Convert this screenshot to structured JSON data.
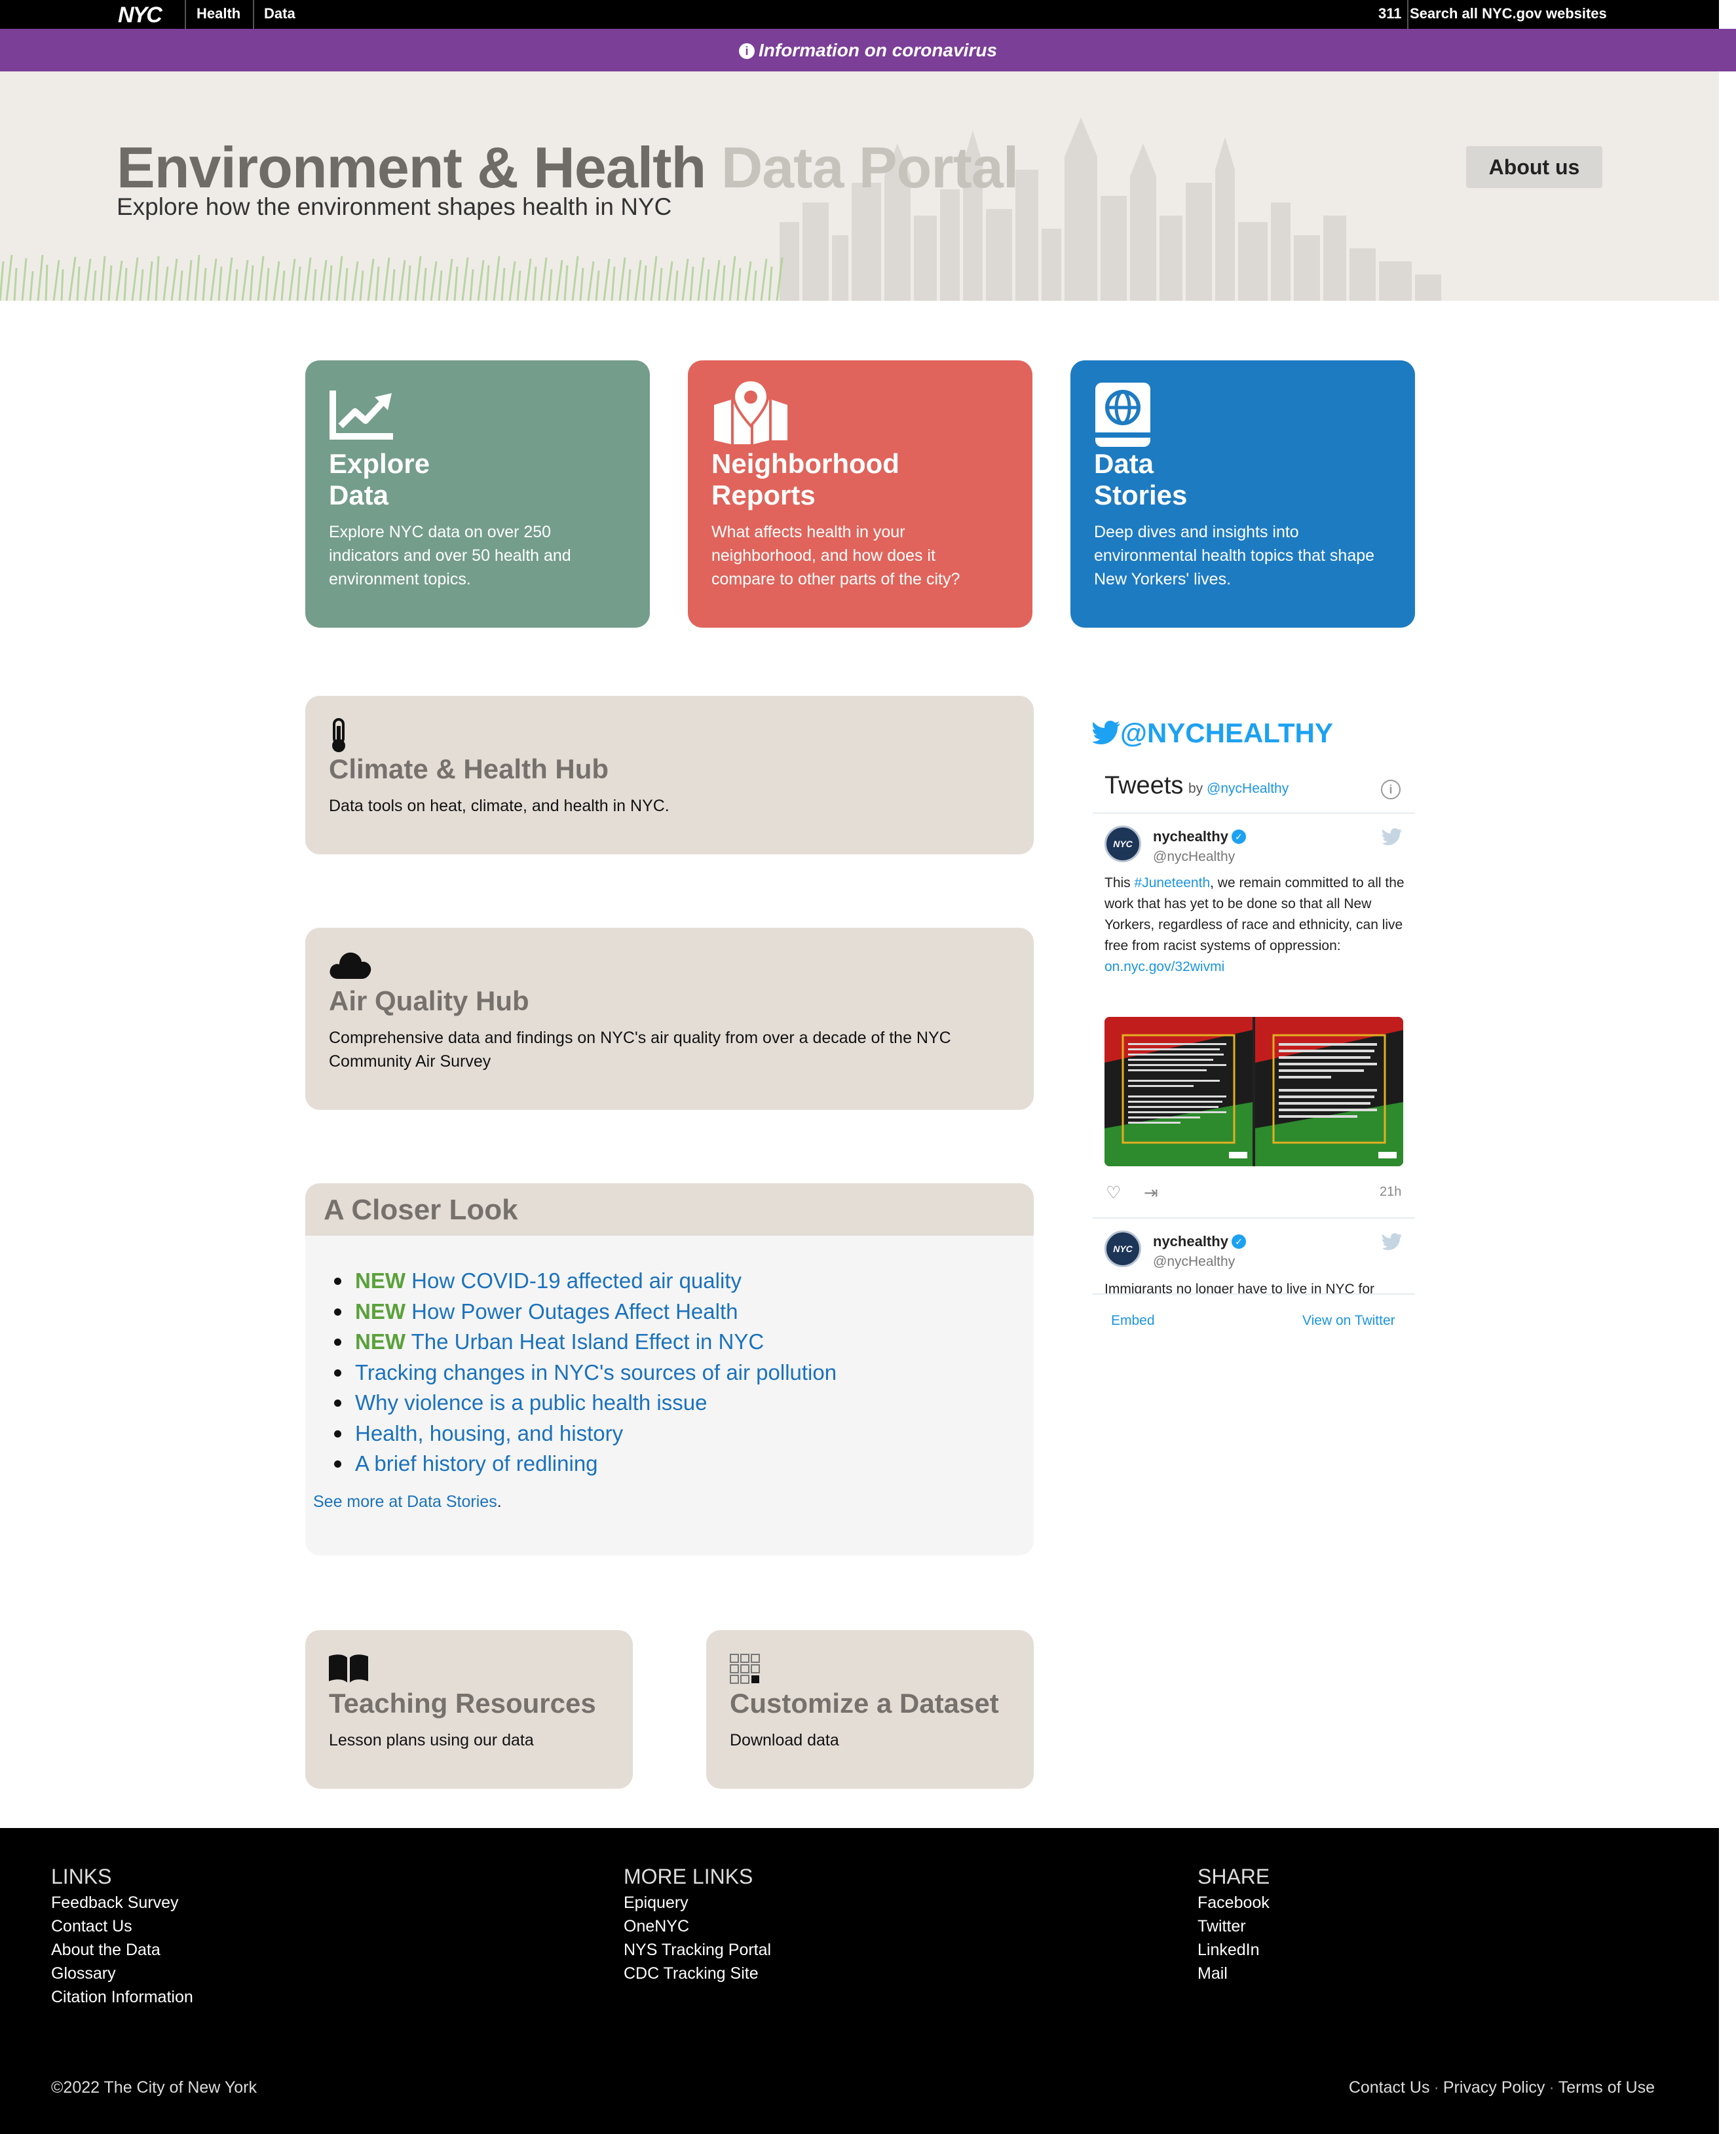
{
  "topbar": {
    "logo": "NYC",
    "links": [
      "Health",
      "Data"
    ],
    "right_311": "311",
    "right_search": "Search all NYC.gov websites"
  },
  "banner": {
    "text": "Information on coronavirus"
  },
  "hero": {
    "title_dark": "Environment & Health ",
    "title_light": "Data Portal",
    "subtitle": "Explore how the environment shapes health in NYC",
    "about_button": "About us"
  },
  "cards": [
    {
      "title": "Explore\nData",
      "desc": "Explore NYC data on over 250 indicators and over 50 health and environment topics.",
      "color": "#749d8c",
      "icon": "line-chart-icon"
    },
    {
      "title": "Neighborhood\nReports",
      "desc": "What affects health in your neighborhood, and how does it compare to other parts of the city?",
      "color": "#e0645b",
      "icon": "map-pin-icon"
    },
    {
      "title": "Data\nStories",
      "desc": "Deep dives and insights into environmental health topics that shape New Yorkers' lives.",
      "color": "#1d7bc2",
      "icon": "globe-book-icon"
    }
  ],
  "hubs": [
    {
      "title": "Climate & Health Hub",
      "desc": "Data tools on heat, climate, and health in NYC.",
      "icon": "thermometer-icon"
    },
    {
      "title": "Air Quality Hub",
      "desc": "Comprehensive data and findings on NYC's air quality from over a decade of the NYC Community Air Survey",
      "icon": "cloud-icon"
    }
  ],
  "closer_look": {
    "title": "A Closer Look",
    "items": [
      {
        "new": "NEW",
        "text": "How COVID-19 affected air quality"
      },
      {
        "new": "NEW",
        "text": "How Power Outages Affect Health"
      },
      {
        "new": "NEW",
        "text": "The Urban Heat Island Effect in NYC"
      },
      {
        "new": "",
        "text": "Tracking changes in NYC's sources of air pollution"
      },
      {
        "new": "",
        "text": "Why violence is a public health issue"
      },
      {
        "new": "",
        "text": "Health, housing, and history"
      },
      {
        "new": "",
        "text": "A brief history of redlining"
      }
    ],
    "see_more": "See more at Data Stories",
    "see_more_period": "."
  },
  "twitter": {
    "handle": "@NYCHEALTHY",
    "widget_title": "Tweets",
    "by_label": "by",
    "by_handle": "@nycHealthy",
    "tweet1": {
      "name": "nychealthy",
      "user": "@nycHealthy",
      "text_before": "This ",
      "hashtag": "#Juneteenth",
      "text_after": ", we remain committed to all the work that has yet to be done so that all New Yorkers, regardless of race and ethnicity, can live free from racist systems of oppression: ",
      "link": "on.nyc.gov/32wivmi",
      "time": "21h"
    },
    "tweet2": {
      "name": "nychealthy",
      "user": "@nycHealthy",
      "text_partial": "Immigrants no longer have to live in NYC for"
    },
    "embed": "Embed",
    "view_on": "View on Twitter",
    "avatar_text": "NYC"
  },
  "bottom_cards": [
    {
      "title": "Teaching Resources",
      "desc": "Lesson plans using our data",
      "icon": "book-icon"
    },
    {
      "title": "Customize a Dataset",
      "desc": "Download data",
      "icon": "grid-icon"
    }
  ],
  "footer": {
    "links_head": "LINKS",
    "links": [
      "Feedback Survey",
      "Contact Us",
      "About the Data",
      "Glossary",
      "Citation Information"
    ],
    "more_head": "MORE LINKS",
    "more_links": [
      "Epiquery",
      "OneNYC",
      "NYS Tracking Portal",
      "CDC Tracking Site"
    ],
    "share_head": "SHARE",
    "share": [
      "Facebook",
      "Twitter",
      "LinkedIn",
      "Mail"
    ],
    "copyright": "©2022 The City of New York",
    "legal": [
      "Contact Us",
      "Privacy Policy",
      "Terms of Use"
    ],
    "legal_sep": "·"
  }
}
